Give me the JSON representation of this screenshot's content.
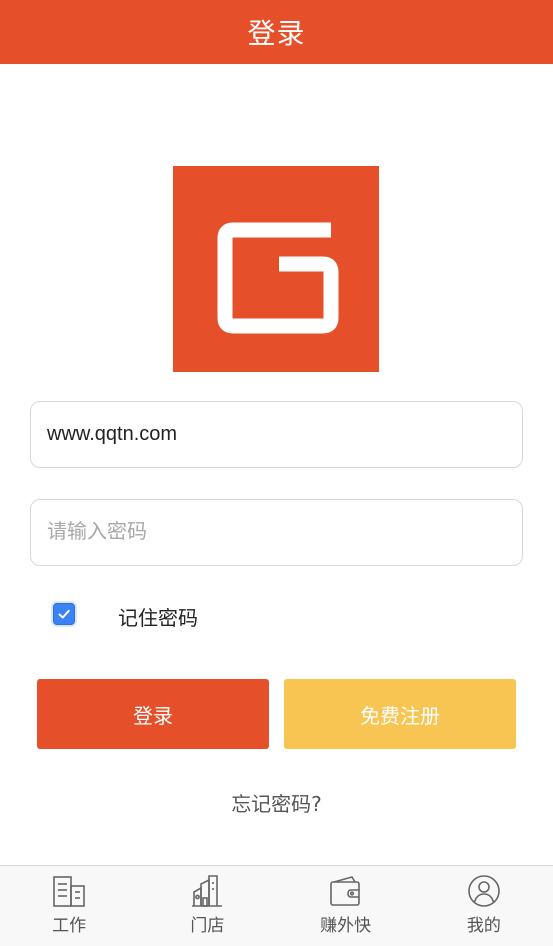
{
  "header": {
    "title": "登录"
  },
  "logo": {
    "letter": "G",
    "color": "#e5502a"
  },
  "login_form": {
    "username_value": "www.qqtn.com",
    "username_placeholder": "",
    "password_value": "",
    "password_placeholder": "请输入密码",
    "remember_label": "记住密码",
    "remember_checked": true,
    "login_button": "登录",
    "register_button": "免费注册",
    "forgot_link": "忘记密码?"
  },
  "colors": {
    "primary": "#e5502a",
    "secondary": "#f8c552",
    "checkbox": "#3b82f6"
  },
  "tabbar": {
    "items": [
      {
        "label": "工作",
        "icon": "building-icon"
      },
      {
        "label": "门店",
        "icon": "store-icon"
      },
      {
        "label": "赚外快",
        "icon": "wallet-icon"
      },
      {
        "label": "我的",
        "icon": "user-icon"
      }
    ]
  }
}
